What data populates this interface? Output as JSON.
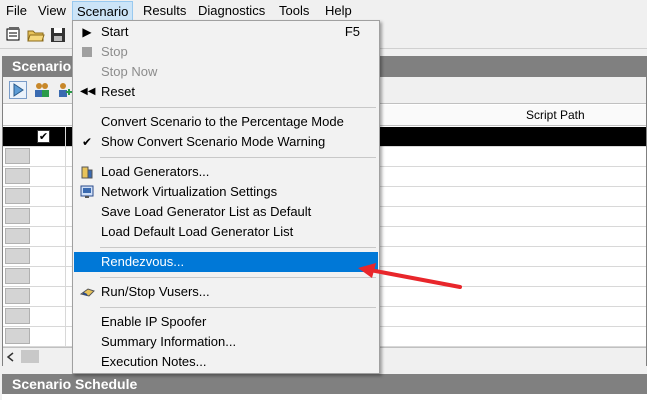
{
  "menubar": {
    "items": [
      "File",
      "View",
      "Scenario",
      "Results",
      "Diagnostics",
      "Tools",
      "Help"
    ]
  },
  "panels": {
    "scenario_title": "Scenario",
    "schedule_title": "Scenario Schedule"
  },
  "grid": {
    "header_script_path": "Script Path",
    "selected_row_checked": "✔"
  },
  "menu": {
    "start": "Start",
    "start_shortcut": "F5",
    "stop": "Stop",
    "stop_now": "Stop Now",
    "reset": "Reset",
    "convert_percentage": "Convert Scenario to the Percentage Mode",
    "show_convert_warning": "Show Convert Scenario Mode Warning",
    "load_generators": "Load Generators...",
    "network_virtualization": "Network Virtualization Settings",
    "save_lg_list": "Save Load Generator List as Default",
    "load_default_lg_list": "Load Default Load Generator List",
    "rendezvous": "Rendezvous...",
    "run_stop_vusers": "Run/Stop Vusers...",
    "enable_ip_spoofer": "Enable IP Spoofer",
    "summary_information": "Summary Information...",
    "execution_notes": "Execution Notes..."
  },
  "colors": {
    "highlight": "#0078d7",
    "panel_title_bg": "#808080",
    "annotation_arrow": "#e8262b"
  }
}
